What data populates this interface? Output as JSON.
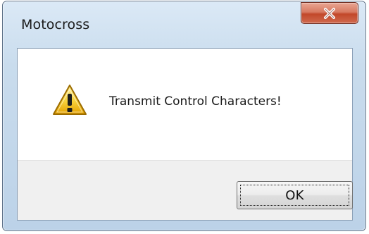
{
  "window": {
    "title": "Motocross",
    "close_icon": "close-icon",
    "accent_color": "#c2482a"
  },
  "message": {
    "icon": "warning-icon",
    "text": "Transmit Control Characters!"
  },
  "buttons": {
    "ok_label": "OK"
  }
}
